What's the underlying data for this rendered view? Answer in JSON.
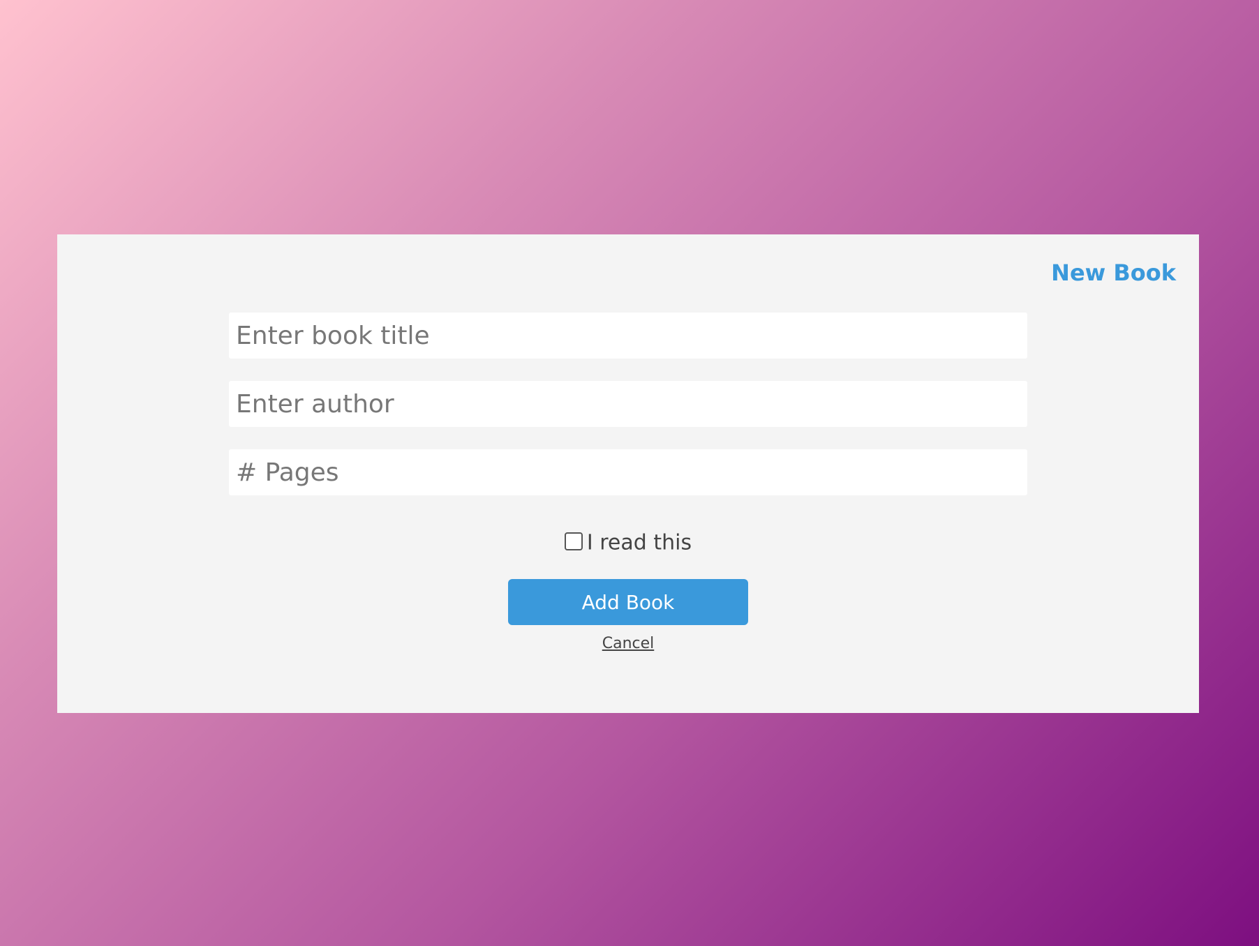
{
  "header": {
    "new_book_link": "New Book"
  },
  "form": {
    "title_placeholder": "Enter book title",
    "author_placeholder": "Enter author",
    "pages_placeholder": "# Pages",
    "read_checkbox_label": "I read this",
    "read_checked": false,
    "add_button_label": "Add Book",
    "cancel_link": "Cancel"
  },
  "colors": {
    "accent": "#3a99db",
    "panel": "#f4f4f4",
    "gradient_start": "#ffc2cf",
    "gradient_end": "#7d0f80"
  }
}
